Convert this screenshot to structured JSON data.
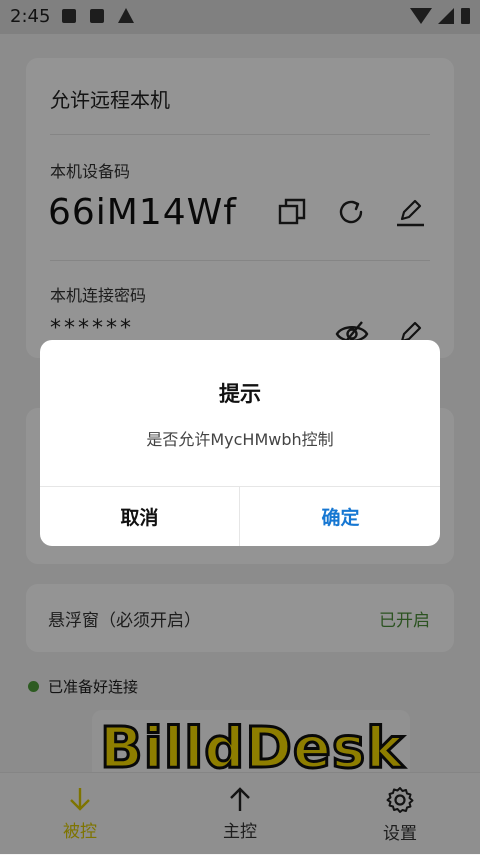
{
  "status_bar": {
    "time": "2:45"
  },
  "card_remote": {
    "title": "允许远程本机",
    "device_code_label": "本机设备码",
    "device_code": "66iM14Wf",
    "password_label": "本机连接密码",
    "password": "******"
  },
  "floating_window": {
    "label": "悬浮窗（必须开启）",
    "value": "已开启",
    "value_color": "#4c8f3a"
  },
  "ready_status": {
    "text": "已准备好连接",
    "dot_color": "#4f9d3a"
  },
  "banner": {
    "text": "BilldDesk"
  },
  "tabbar": {
    "items": [
      {
        "label": "被控",
        "icon": "arrow-down-icon",
        "active": true
      },
      {
        "label": "主控",
        "icon": "arrow-up-icon",
        "active": false
      },
      {
        "label": "设置",
        "icon": "gear-icon",
        "active": false
      }
    ],
    "active_color": "#d9c800"
  },
  "dialog": {
    "title": "提示",
    "message": "是否允许MycHMwbh控制",
    "cancel_label": "取消",
    "confirm_label": "确定",
    "confirm_color": "#1677d2"
  }
}
